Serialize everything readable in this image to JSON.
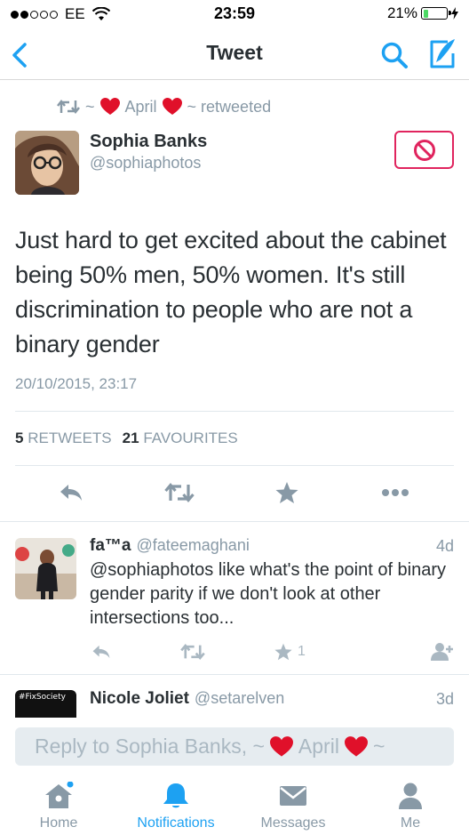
{
  "status_bar": {
    "carrier": "EE",
    "time": "23:59",
    "battery_percent": "21%",
    "battery_level": 0.21
  },
  "nav": {
    "title": "Tweet"
  },
  "tweet": {
    "retweeted_by_prefix": "~",
    "retweeted_by_name": "April",
    "retweeted_suffix": "~ retweeted",
    "author_name": "Sophia Banks",
    "author_handle": "@sophiaphotos",
    "text": "Just hard to get excited about the cabinet being 50% men, 50% women. It's still discrimination to people who are not a binary gender",
    "timestamp": "20/10/2015, 23:17",
    "retweets_count": "5",
    "retweets_label": "RETWEETS",
    "favourites_count": "21",
    "favourites_label": "FAVOURITES"
  },
  "replies": [
    {
      "name": "fa™a",
      "handle": "@fateemaghani",
      "age": "4d",
      "text": "@sophiaphotos like what's the point of binary gender parity if we don't look at other intersections too...",
      "favourite_count": "1"
    },
    {
      "name": "Nicole Joliet",
      "handle": "@setarelven",
      "age": "3d",
      "avatar_text": "#FixSociety"
    }
  ],
  "reply_bar": {
    "placeholder_prefix": "Reply to Sophia Banks, ~",
    "placeholder_name": "April",
    "placeholder_suffix": "~"
  },
  "tabs": [
    {
      "label": "Home",
      "icon": "home-icon"
    },
    {
      "label": "Notifications",
      "icon": "bell-icon"
    },
    {
      "label": "Messages",
      "icon": "envelope-icon"
    },
    {
      "label": "Me",
      "icon": "person-icon"
    }
  ],
  "colors": {
    "accent": "#1da1f2",
    "block_red": "#e0245e",
    "heart_red": "#e0102a",
    "muted": "#8899a6"
  }
}
